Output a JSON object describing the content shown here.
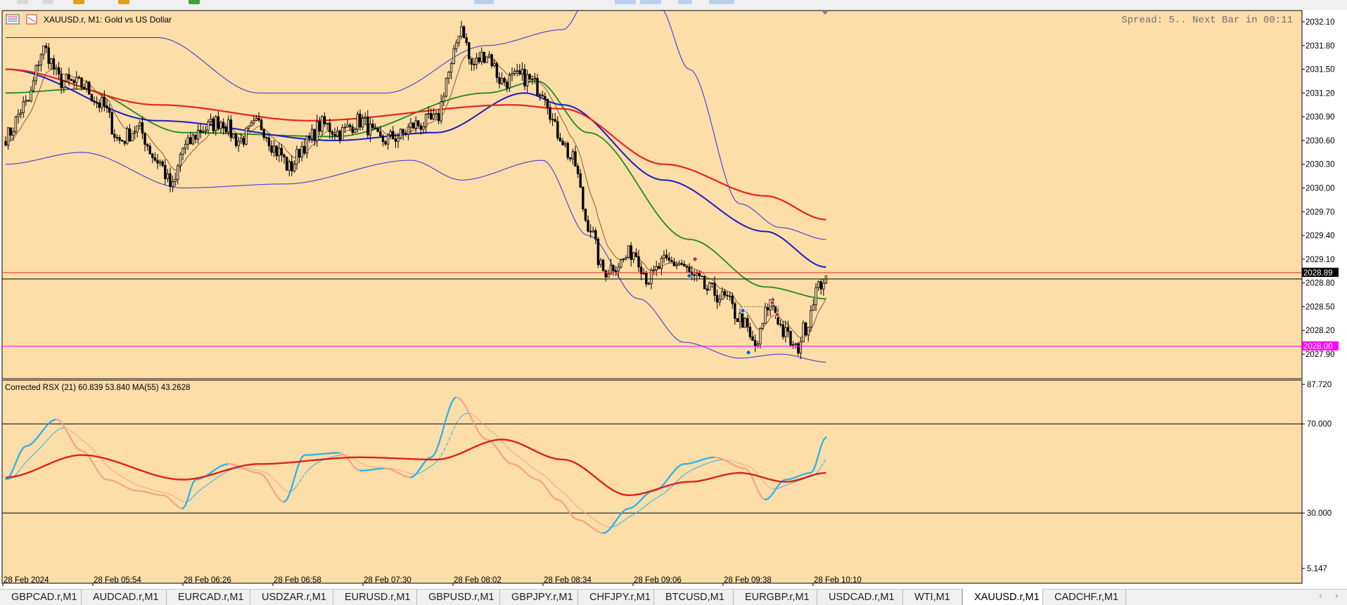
{
  "window": {
    "symbol_title": "XAUUSD.r, M1:  Gold vs US Dollar",
    "spread_info": "Spread: 5.. Next Bar in 00:11"
  },
  "colors": {
    "background": "#FDDDA8",
    "bull_candle": "#FDDDA8",
    "bear_candle": "#000000",
    "ma_red": "#E8241E",
    "ma_blue": "#1B1BC8",
    "ma_green": "#1E8C1E",
    "ma_brown": "#8B5A3C",
    "bands": "#3030D8",
    "rsx_up": "#22B4F0",
    "rsx_down": "#F4A488",
    "rsx_ma": "#DD2218",
    "line_bid": "#E8241E",
    "line_ask": "#000000",
    "line_level": "#FF00FF"
  },
  "price_axis": {
    "ticks": [
      "2032.10",
      "2031.80",
      "2031.50",
      "2031.20",
      "2030.90",
      "2030.60",
      "2030.30",
      "2030.00",
      "2029.70",
      "2029.40",
      "2029.10",
      "2028.80",
      "2028.50",
      "2028.20",
      "2027.90"
    ],
    "current_price_label": "2028.89",
    "level_label": "2028.00",
    "range": [
      2027.6,
      2032.2
    ]
  },
  "indicator": {
    "title": "Corrected RSX (21) 60.839 53.840 MA(55) 43.2628",
    "ticks": [
      "87.720",
      "70.000",
      "30.000",
      "5.147"
    ],
    "range": [
      5.147,
      87.72
    ],
    "levels": [
      70,
      30
    ]
  },
  "time_axis": {
    "labels": [
      "28 Feb 2024",
      "28 Feb 05:54",
      "28 Feb 06:26",
      "28 Feb 06:58",
      "28 Feb 07:30",
      "28 Feb 08:02",
      "28 Feb 08:34",
      "28 Feb 09:06",
      "28 Feb 09:38",
      "28 Feb 10:10"
    ]
  },
  "tabs": [
    {
      "label": "GBPCAD.r,M1",
      "active": false
    },
    {
      "label": "AUDCAD.r,M1",
      "active": false
    },
    {
      "label": "EURCAD.r,M1",
      "active": false
    },
    {
      "label": "USDZAR.r,M1",
      "active": false
    },
    {
      "label": "EURUSD.r,M1",
      "active": false
    },
    {
      "label": "GBPUSD.r,M1",
      "active": false
    },
    {
      "label": "GBPJPY.r,M1",
      "active": false
    },
    {
      "label": "CHFJPY.r,M1",
      "active": false
    },
    {
      "label": "BTCUSD,M1",
      "active": false
    },
    {
      "label": "EURGBP.r,M1",
      "active": false
    },
    {
      "label": "USDCAD.r,M1",
      "active": false
    },
    {
      "label": "WTI,M1",
      "active": false
    },
    {
      "label": "XAUUSD.r,M1",
      "active": true
    },
    {
      "label": "CADCHF.r,M1",
      "active": false
    }
  ],
  "chart_data": {
    "type": "candlestick",
    "price_key_points": [
      [
        0,
        2030.65
      ],
      [
        8,
        2031.05
      ],
      [
        15,
        2031.75
      ],
      [
        22,
        2031.35
      ],
      [
        30,
        2031.3
      ],
      [
        38,
        2031.05
      ],
      [
        45,
        2030.6
      ],
      [
        52,
        2030.75
      ],
      [
        60,
        2030.35
      ],
      [
        66,
        2030.0
      ],
      [
        70,
        2030.5
      ],
      [
        78,
        2030.75
      ],
      [
        85,
        2030.85
      ],
      [
        92,
        2030.6
      ],
      [
        100,
        2030.8
      ],
      [
        108,
        2030.45
      ],
      [
        112,
        2030.25
      ],
      [
        118,
        2030.55
      ],
      [
        125,
        2030.8
      ],
      [
        132,
        2030.7
      ],
      [
        140,
        2030.85
      ],
      [
        148,
        2030.6
      ],
      [
        155,
        2030.65
      ],
      [
        162,
        2030.8
      ],
      [
        170,
        2030.85
      ],
      [
        175,
        2031.45
      ],
      [
        180,
        2032.05
      ],
      [
        184,
        2031.55
      ],
      [
        190,
        2031.7
      ],
      [
        196,
        2031.35
      ],
      [
        204,
        2031.4
      ],
      [
        212,
        2031.25
      ],
      [
        218,
        2030.7
      ],
      [
        224,
        2030.35
      ],
      [
        230,
        2029.55
      ],
      [
        236,
        2028.95
      ],
      [
        242,
        2029.05
      ],
      [
        248,
        2029.2
      ],
      [
        254,
        2028.85
      ],
      [
        260,
        2029.05
      ],
      [
        266,
        2029.05
      ],
      [
        272,
        2028.85
      ],
      [
        278,
        2028.7
      ],
      [
        284,
        2028.6
      ],
      [
        290,
        2028.35
      ],
      [
        296,
        2028.0
      ],
      [
        302,
        2028.55
      ],
      [
        308,
        2028.15
      ],
      [
        312,
        2027.95
      ],
      [
        316,
        2028.25
      ],
      [
        320,
        2028.7
      ],
      [
        324,
        2028.89
      ]
    ],
    "rsx_key_points": [
      [
        0,
        45
      ],
      [
        8,
        60
      ],
      [
        20,
        72
      ],
      [
        30,
        58
      ],
      [
        40,
        45
      ],
      [
        52,
        40
      ],
      [
        62,
        38
      ],
      [
        70,
        32
      ],
      [
        75,
        45
      ],
      [
        88,
        52
      ],
      [
        100,
        48
      ],
      [
        110,
        35
      ],
      [
        118,
        56
      ],
      [
        132,
        57
      ],
      [
        140,
        49
      ],
      [
        150,
        50
      ],
      [
        160,
        46
      ],
      [
        168,
        55
      ],
      [
        178,
        82
      ],
      [
        190,
        63
      ],
      [
        200,
        52
      ],
      [
        210,
        45
      ],
      [
        218,
        36
      ],
      [
        226,
        27
      ],
      [
        236,
        21
      ],
      [
        246,
        32
      ],
      [
        256,
        40
      ],
      [
        268,
        52
      ],
      [
        280,
        55
      ],
      [
        292,
        50
      ],
      [
        300,
        36
      ],
      [
        308,
        45
      ],
      [
        318,
        48
      ],
      [
        324,
        64
      ]
    ],
    "rsx_ma_key_points": [
      [
        0,
        46
      ],
      [
        30,
        56
      ],
      [
        70,
        45
      ],
      [
        100,
        52
      ],
      [
        140,
        55
      ],
      [
        170,
        54
      ],
      [
        196,
        63
      ],
      [
        220,
        54
      ],
      [
        246,
        38
      ],
      [
        270,
        44
      ],
      [
        290,
        48
      ],
      [
        308,
        44
      ],
      [
        324,
        48
      ]
    ],
    "ma_red_key_points": [
      [
        0,
        2031.5
      ],
      [
        60,
        2031.05
      ],
      [
        120,
        2030.85
      ],
      [
        200,
        2031.05
      ],
      [
        220,
        2031.0
      ],
      [
        260,
        2030.3
      ],
      [
        300,
        2029.9
      ],
      [
        324,
        2029.6
      ]
    ],
    "ma_blue_key_points": [
      [
        0,
        2031.5
      ],
      [
        60,
        2030.85
      ],
      [
        130,
        2030.6
      ],
      [
        170,
        2030.7
      ],
      [
        205,
        2031.2
      ],
      [
        220,
        2031.05
      ],
      [
        260,
        2030.1
      ],
      [
        300,
        2029.45
      ],
      [
        324,
        2029.0
      ]
    ],
    "ma_green_key_points": [
      [
        0,
        2031.2
      ],
      [
        30,
        2031.25
      ],
      [
        70,
        2030.7
      ],
      [
        130,
        2030.65
      ],
      [
        190,
        2031.2
      ],
      [
        210,
        2031.35
      ],
      [
        230,
        2030.7
      ],
      [
        270,
        2029.35
      ],
      [
        300,
        2028.75
      ],
      [
        324,
        2028.6
      ]
    ],
    "band_upper_key_points": [
      [
        0,
        2031.9
      ],
      [
        30,
        2031.9
      ],
      [
        60,
        2031.9
      ],
      [
        100,
        2031.2
      ],
      [
        150,
        2031.2
      ],
      [
        190,
        2031.8
      ],
      [
        220,
        2032.0
      ],
      [
        232,
        2032.5
      ],
      [
        258,
        2032.3
      ],
      [
        270,
        2031.5
      ],
      [
        290,
        2029.8
      ],
      [
        306,
        2029.5
      ],
      [
        324,
        2029.35
      ]
    ],
    "band_lower_key_points": [
      [
        0,
        2030.3
      ],
      [
        30,
        2030.45
      ],
      [
        70,
        2030.0
      ],
      [
        110,
        2030.05
      ],
      [
        160,
        2030.35
      ],
      [
        180,
        2030.1
      ],
      [
        212,
        2030.35
      ],
      [
        230,
        2029.4
      ],
      [
        250,
        2028.6
      ],
      [
        268,
        2028.05
      ],
      [
        290,
        2027.85
      ],
      [
        306,
        2027.9
      ],
      [
        324,
        2027.8
      ]
    ],
    "bar_count": 325
  }
}
